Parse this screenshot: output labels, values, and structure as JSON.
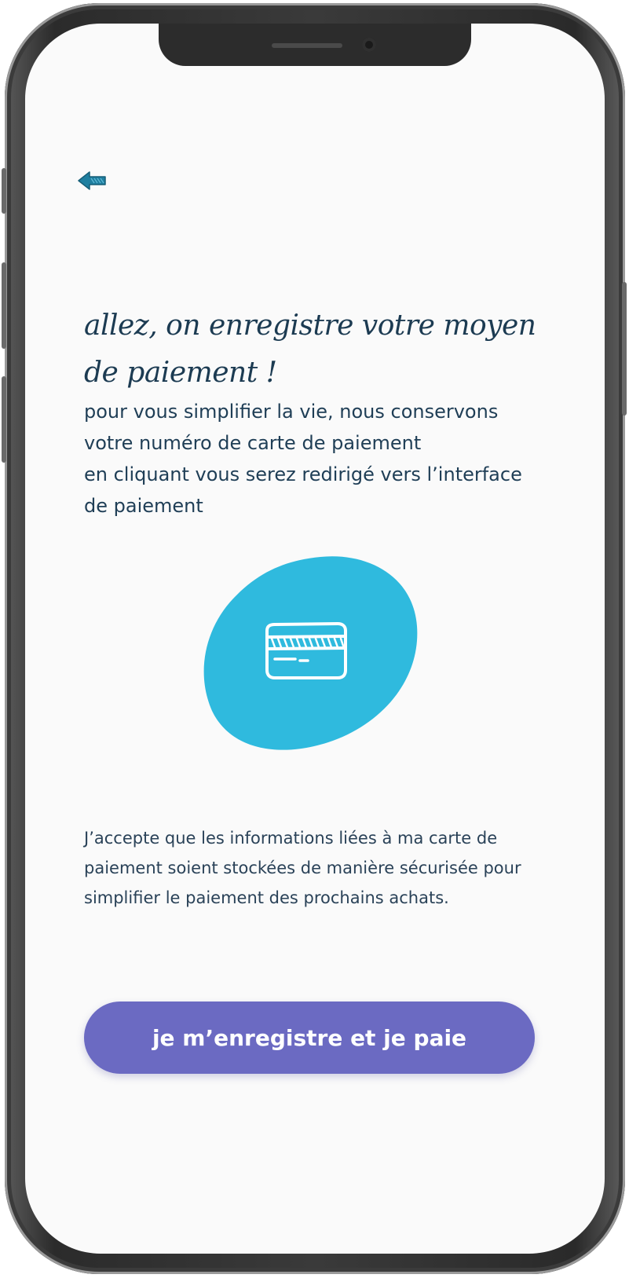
{
  "header": {
    "back_icon": "back-arrow-icon",
    "accent": "#1f7fa0"
  },
  "main": {
    "title": "allez, on enregistre votre moyen de paiement !",
    "description_lines": [
      "pour vous simplifier la vie, nous conservons",
      "votre numéro de carte de paiement",
      "en cliquant vous serez redirigé vers l’interface",
      "de paiement"
    ],
    "illustration_icon": "credit-card-icon",
    "illustration_color": "#2fbade",
    "consent_text": "J’accepte que les informations liées à ma carte de paiement soient stockées de manière sécurisée pour simplifier le paiement des prochains achats."
  },
  "cta": {
    "label": "je m’enregistre et je paie",
    "color": "#6b6ac2"
  }
}
